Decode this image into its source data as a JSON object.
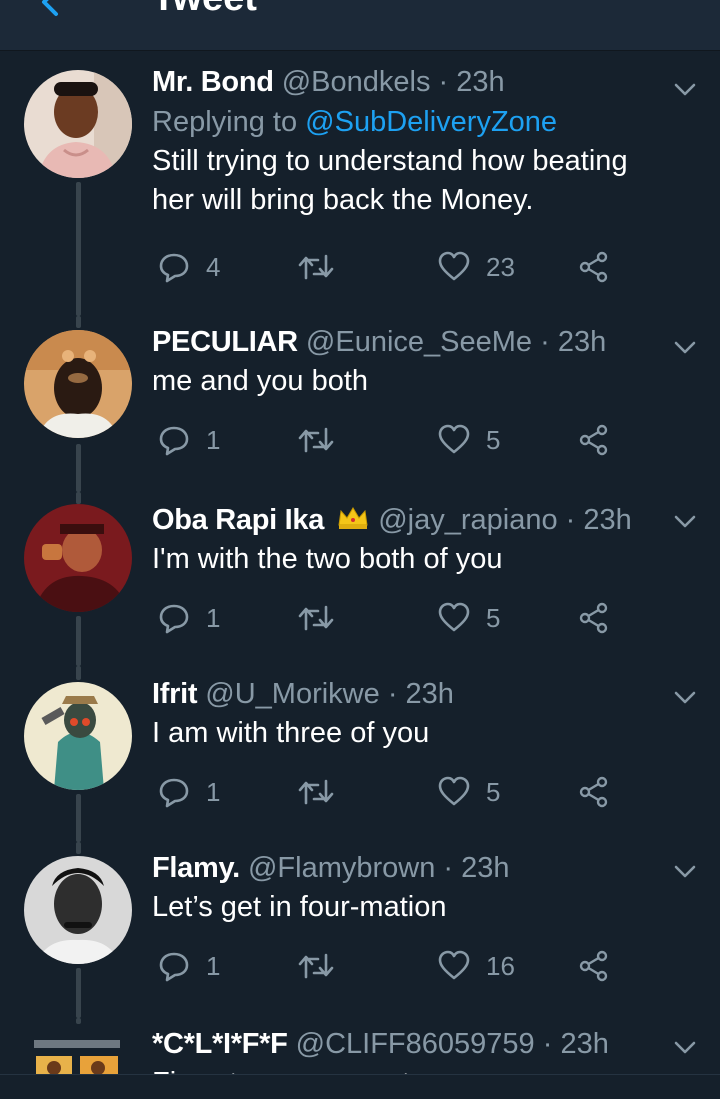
{
  "topbar": {
    "title": "Tweet"
  },
  "tweets": [
    {
      "name": "Mr. Bond",
      "handle": "@Bondkels",
      "time": "23h",
      "replying_prefix": "Replying to ",
      "replying_to": "@SubDeliveryZone",
      "text_line1": "Still trying to understand how beating",
      "text_line2": "her will bring back the Money.",
      "replies": "4",
      "retweets": "",
      "likes": "23"
    },
    {
      "name": "PECULIAR",
      "handle": "@Eunice_SeeMe",
      "time": "23h",
      "text": "me and you both",
      "replies": "1",
      "retweets": "",
      "likes": "5"
    },
    {
      "name": "Oba Rapi Ika",
      "handle": "@jay_rapiano",
      "time": "23h",
      "text": "I'm with the two both of you",
      "replies": "1",
      "retweets": "",
      "likes": "5"
    },
    {
      "name": "Ifrit",
      "handle": "@U_Morikwe",
      "time": "23h",
      "text": "I am with three of you",
      "replies": "1",
      "retweets": "",
      "likes": "5"
    },
    {
      "name": "Flamy.",
      "handle": "@Flamybrown",
      "time": "23h",
      "text": "Let’s get in four-mation",
      "replies": "1",
      "retweets": "",
      "likes": "16"
    },
    {
      "name": "*C*L*I*F*F",
      "handle": "@CLIFF86059759",
      "time": "23h",
      "text": "Five star agreement"
    }
  ],
  "colors": {
    "background": "#15202b",
    "secondary_text": "#8899a6",
    "link": "#1da1f2",
    "thread_line": "#38444d"
  },
  "icons": {
    "back": "arrow-left-icon",
    "reply": "reply-bubble-icon",
    "retweet": "retweet-icon",
    "like": "heart-icon",
    "share": "share-icon",
    "more": "chevron-down-icon",
    "verified_badge": "crown-emoji-icon"
  }
}
